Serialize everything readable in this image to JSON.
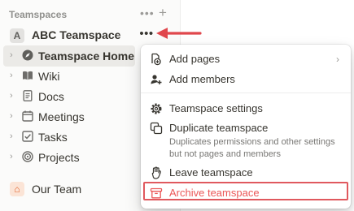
{
  "sidebar": {
    "section_title": "Teamspaces",
    "header_more": "•••",
    "header_add": "+",
    "workspace": {
      "badge": "A",
      "name": "ABC Teamspace",
      "caret": "⌄",
      "more": "•••"
    },
    "items": [
      {
        "label": "Teamspace Home",
        "icon": "compass-icon",
        "selected": true
      },
      {
        "label": "Wiki",
        "icon": "book-icon"
      },
      {
        "label": "Docs",
        "icon": "document-icon"
      },
      {
        "label": "Meetings",
        "icon": "calendar-icon"
      },
      {
        "label": "Tasks",
        "icon": "checkbox-icon"
      },
      {
        "label": "Projects",
        "icon": "target-icon"
      }
    ],
    "team": {
      "label": "Our Team",
      "icon": "home-icon"
    }
  },
  "menu": {
    "add_pages": "Add pages",
    "add_members": "Add members",
    "teamspace_settings": "Teamspace settings",
    "duplicate_teamspace": "Duplicate teamspace",
    "duplicate_description": "Duplicates permissions and other settings but not pages and members",
    "leave_teamspace": "Leave teamspace",
    "archive_teamspace": "Archive teamspace"
  },
  "colors": {
    "danger": "#eb5757",
    "highlight": "#e0595e",
    "arrow": "#e0474c",
    "home_icon": "#e0612a"
  }
}
